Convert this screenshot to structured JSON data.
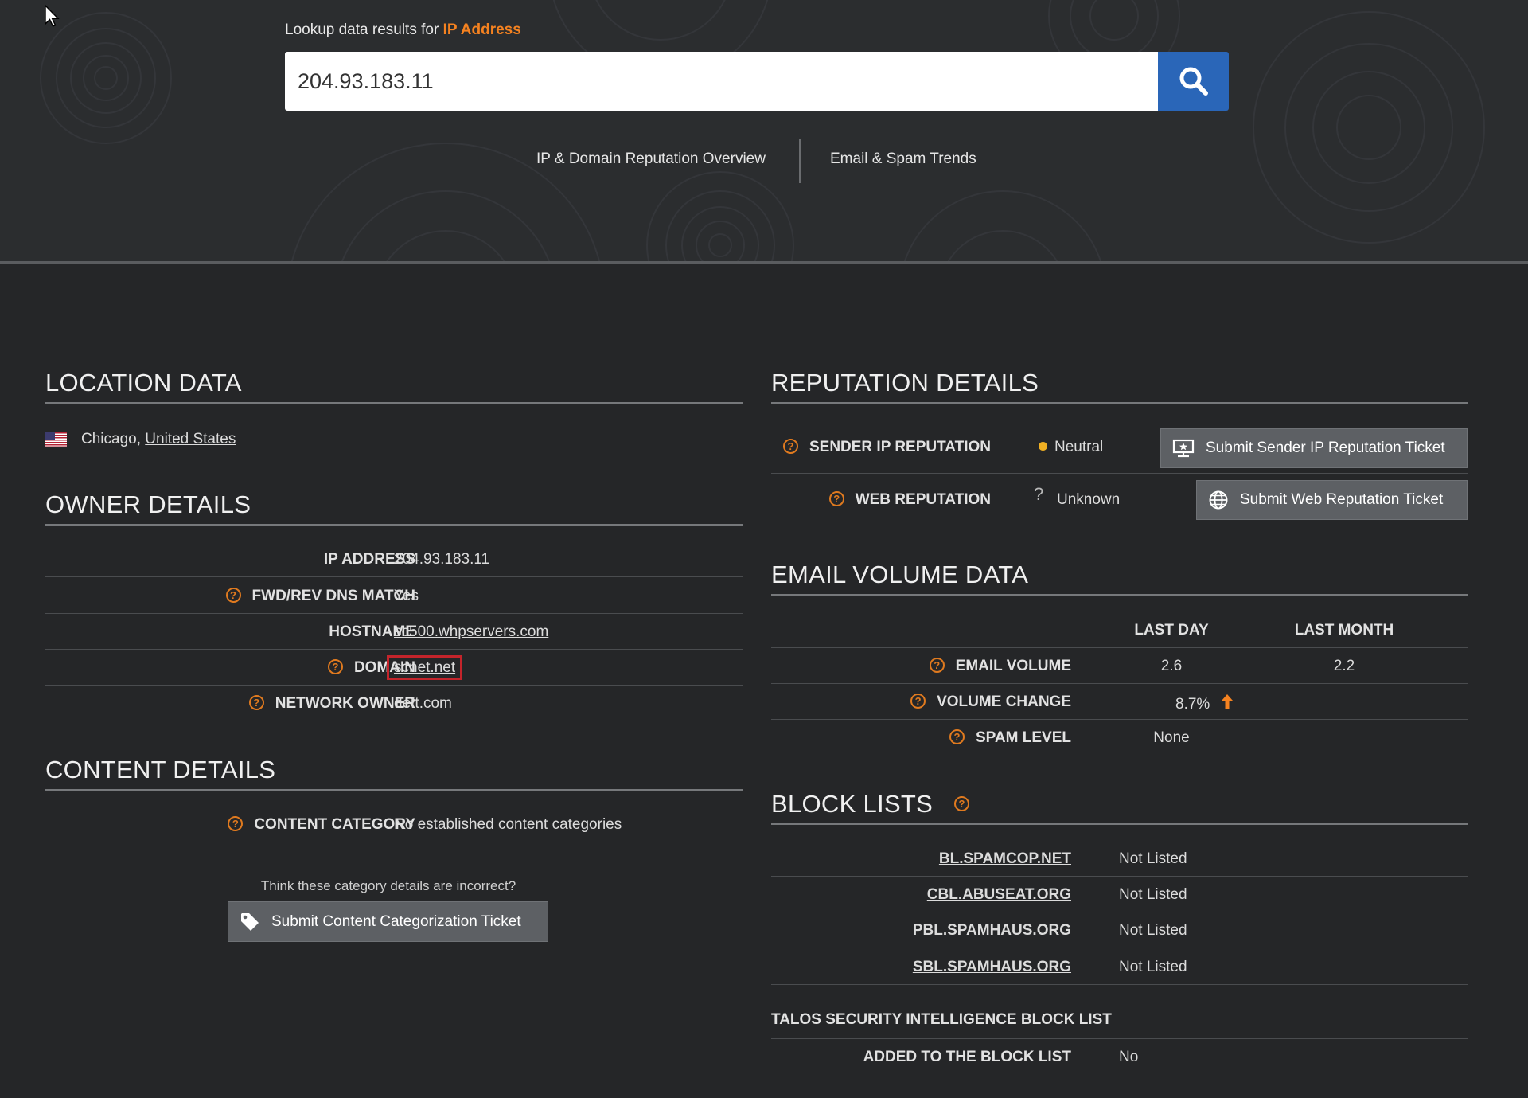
{
  "search": {
    "label_prefix": "Lookup data results for",
    "label_type": "IP Address",
    "value": "204.93.183.11"
  },
  "nav": {
    "overview": "IP & Domain Reputation Overview",
    "trends": "Email & Spam Trends"
  },
  "location": {
    "title": "LOCATION DATA",
    "city": "Chicago,",
    "country": "United States"
  },
  "owner": {
    "title": "OWNER DETAILS",
    "rows": [
      {
        "label": "IP ADDRESS",
        "value": "204.93.183.11"
      },
      {
        "label": "FWD/REV DNS MATCH",
        "value": "Yes"
      },
      {
        "label": "HOSTNAME",
        "value": "sc500.whpservers.com"
      },
      {
        "label": "DOMAIN",
        "value": "scnet.net"
      },
      {
        "label": "NETWORK OWNER",
        "value": "deft.com"
      }
    ]
  },
  "content": {
    "title": "CONTENT DETAILS",
    "category_label": "CONTENT CATEGORY",
    "category_value": "No established content categories",
    "incorrect_prompt": "Think these category details are incorrect?",
    "ticket_button": "Submit Content Categorization Ticket"
  },
  "reputation": {
    "title": "REPUTATION DETAILS",
    "sender_label": "SENDER IP REPUTATION",
    "sender_value": "Neutral",
    "sender_button": "Submit Sender IP Reputation Ticket",
    "web_label": "WEB REPUTATION",
    "web_mark": "?",
    "web_value": "Unknown",
    "web_button": "Submit Web Reputation Ticket"
  },
  "email_volume": {
    "title": "EMAIL VOLUME DATA",
    "col_day": "LAST DAY",
    "col_month": "LAST MONTH",
    "rows": [
      {
        "label": "EMAIL VOLUME",
        "day": "2.6",
        "month": "2.2"
      },
      {
        "label": "VOLUME CHANGE",
        "day": "8.7%",
        "month": ""
      },
      {
        "label": "SPAM LEVEL",
        "day": "None",
        "month": ""
      }
    ]
  },
  "block_lists": {
    "title": "BLOCK LISTS",
    "rows": [
      {
        "label": "BL.SPAMCOP.NET",
        "value": "Not Listed"
      },
      {
        "label": "CBL.ABUSEAT.ORG",
        "value": "Not Listed"
      },
      {
        "label": "PBL.SPAMHAUS.ORG",
        "value": "Not Listed"
      },
      {
        "label": "SBL.SPAMHAUS.ORG",
        "value": "Not Listed"
      }
    ],
    "talos_title": "TALOS SECURITY INTELLIGENCE BLOCK LIST",
    "added_label": "ADDED TO THE BLOCK LIST",
    "added_value": "No"
  },
  "colors": {
    "accent": "#f58220",
    "search_button": "#2a66b8",
    "neutral_dot": "#f0b023",
    "highlight_border": "#c4242b"
  },
  "icons": [
    "mouse-cursor-icon",
    "search-icon",
    "us-flag-icon",
    "help-icon",
    "sender-ip-icon",
    "globe-icon",
    "tag-icon",
    "arrow-up-icon"
  ]
}
